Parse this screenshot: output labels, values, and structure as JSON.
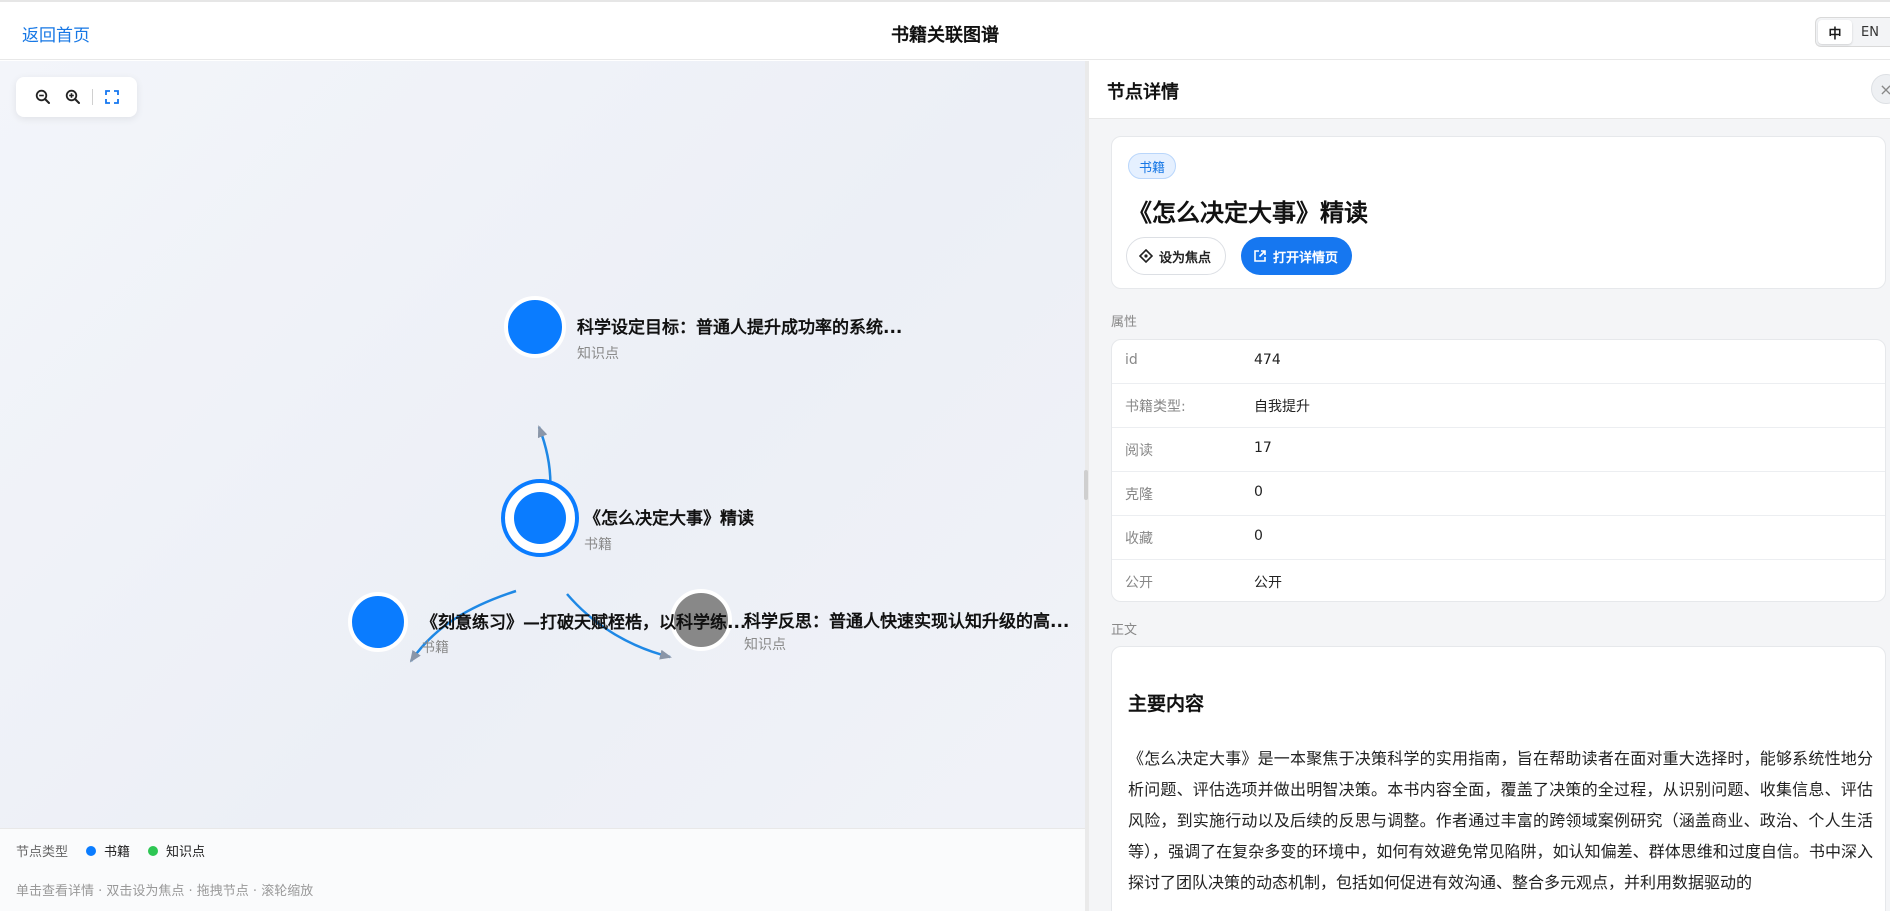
{
  "header": {
    "back_label": "返回首页",
    "title": "书籍关联图谱",
    "lang_zh": "中",
    "lang_en": "EN"
  },
  "graph": {
    "toolbar": {
      "zoom_out_icon": "zoom-out-icon",
      "zoom_in_icon": "zoom-in-icon",
      "fit_icon": "fit-screen-icon"
    },
    "nodes": [
      {
        "label": "科学设定目标：普通人提升成功率的系统...",
        "type": "知识点",
        "color": "#0a7cff"
      },
      {
        "label": "《怎么决定大事》精读",
        "type": "书籍",
        "color": "#0a7cff"
      },
      {
        "label": "《刻意练习》—打破天赋桎梏，以科学练...",
        "type": "书籍",
        "color": "#0a7cff"
      },
      {
        "label": "科学反思：普通人快速实现认知升级的高...",
        "type": "知识点",
        "color": "#888888"
      }
    ],
    "legend": {
      "title": "节点类型",
      "items": [
        {
          "label": "书籍",
          "color": "#0a7cff"
        },
        {
          "label": "知识点",
          "color": "#2dc653"
        }
      ]
    },
    "hint": "单击查看详情 · 双击设为焦点 · 拖拽节点 · 滚轮缩放"
  },
  "detail": {
    "panel_title": "节点详情",
    "close_label": "×",
    "badge": "书籍",
    "node_title": "《怎么决定大事》精读",
    "focus_button": "设为焦点",
    "open_button": "打开详情页",
    "props_label": "属性",
    "props": [
      {
        "key": "id",
        "value": "474"
      },
      {
        "key": "书籍类型:",
        "value": "自我提升"
      },
      {
        "key": "阅读",
        "value": "17"
      },
      {
        "key": "克隆",
        "value": "0"
      },
      {
        "key": "收藏",
        "value": "0"
      },
      {
        "key": "公开",
        "value": "公开"
      }
    ],
    "body_label": "正文",
    "body_heading": "主要内容",
    "body_text": "《怎么决定大事》是一本聚焦于决策科学的实用指南，旨在帮助读者在面对重大选择时，能够系统性地分析问题、评估选项并做出明智决策。本书内容全面，覆盖了决策的全过程，从识别问题、收集信息、评估风险，到实施行动以及后续的反思与调整。作者通过丰富的跨领域案例研究（涵盖商业、政治、个人生活等），强调了在复杂多变的环境中，如何有效避免常见陷阱，如认知偏差、群体思维和过度自信。书中深入探讨了团队决策的动态机制，包括如何促进有效沟通、整合多元观点，并利用数据驱动的"
  },
  "colors": {
    "accent": "#1677f0",
    "link": "#1677e5",
    "book_node": "#0a7cff",
    "knowledge_node": "#2dc653",
    "dimmed_node": "#888888"
  }
}
